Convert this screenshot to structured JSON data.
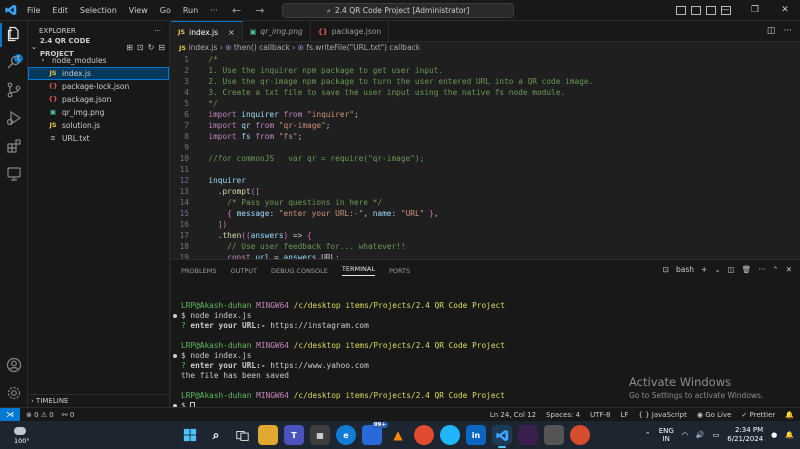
{
  "titlebar": {
    "menu": [
      "File",
      "Edit",
      "Selection",
      "View",
      "Go",
      "Run",
      "···"
    ],
    "search": "2.4 QR Code Project [Administrator]"
  },
  "sidebar": {
    "title": "EXPLORER",
    "more": "···",
    "project": "2.4 QR CODE PROJECT",
    "items": [
      {
        "icon": "›",
        "label": "node_modules",
        "color": "#cccccc"
      },
      {
        "icon": "JS",
        "label": "index.js",
        "color": "#cccccc"
      },
      {
        "icon": "{}",
        "label": "package-lock.json",
        "color": "#cccccc"
      },
      {
        "icon": "{}",
        "label": "package.json",
        "color": "#cccccc"
      },
      {
        "icon": "▣",
        "label": "qr_img.png",
        "color": "#cccccc"
      },
      {
        "icon": "JS",
        "label": "solution.js",
        "color": "#cccccc"
      },
      {
        "icon": "≡",
        "label": "URL.txt",
        "color": "#cccccc"
      }
    ],
    "timeline": "TIMELINE"
  },
  "tabs": [
    {
      "icon": "JS",
      "label": "index.js",
      "close": "×"
    },
    {
      "icon": "▣",
      "label": "qr_img.png"
    },
    {
      "icon": "{}",
      "label": "package.json"
    }
  ],
  "breadcrumbs": {
    "file": "index.js",
    "sep": " › ",
    "fn1": "then() callback",
    "fn2": "fs.writeFile(\"URL.txt\") callback"
  },
  "code": [
    {
      "n": "1",
      "t": "  /*"
    },
    {
      "n": "2",
      "t": "  1. Use the inquirer npm package to get user input."
    },
    {
      "n": "3",
      "t": "  2. Use the qr-image npm package to turn the user entered URL into a QR code image."
    },
    {
      "n": "4",
      "t": "  3. Create a txt file to save the user input using the native fs node module."
    },
    {
      "n": "5",
      "t": "  */"
    },
    {
      "n": "6",
      "t": "  import inquirer from \"inquirer\";"
    },
    {
      "n": "7",
      "t": "  import qr from \"qr-image\";"
    },
    {
      "n": "8",
      "t": "  import fs from \"fs\";"
    },
    {
      "n": "9",
      "t": ""
    },
    {
      "n": "10",
      "t": "  //for commonJS   var qr = require(\"qr-image\");"
    },
    {
      "n": "11",
      "t": ""
    },
    {
      "n": "12",
      "t": "  inquirer"
    },
    {
      "n": "13",
      "t": "    .prompt(["
    },
    {
      "n": "14",
      "t": "      /* Pass your questions in here */"
    },
    {
      "n": "15",
      "t": "      { message: \"enter your URL:-\", name: \"URL\" },"
    },
    {
      "n": "16",
      "t": "    ])"
    },
    {
      "n": "17",
      "t": "    .then((answers) => {"
    },
    {
      "n": "18",
      "t": "      // Use user feedback for... whatever!!"
    },
    {
      "n": "19",
      "t": "      const url = answers.URL;"
    }
  ],
  "panel": {
    "tabs": [
      "PROBLEMS",
      "OUTPUT",
      "DEBUG CONSOLE",
      "TERMINAL",
      "PORTS"
    ],
    "shell": "bash",
    "add": "+",
    "more": "···"
  },
  "terminal": {
    "user": "LRP@Akash-duhan",
    "host": "MINGW64",
    "path": "/c/desktop items/Projects/2.4 QR Code Project",
    "prompt": "$",
    "cmd": "node index.js",
    "q": "?",
    "q1": " enter your URL:-",
    "a1": " https://instagram.com",
    "a2": " https://www.yahoo.com",
    "saved": "the file has been saved"
  },
  "watermark": {
    "title": "Activate Windows",
    "subtitle": "Go to Settings to activate Windows."
  },
  "statusbar": {
    "errors": "⊗ 0 ⚠ 0",
    "ports": "⚯ 0",
    "position": "Ln 24, Col 12",
    "spaces": "Spaces: 4",
    "encoding": "UTF-8",
    "eol": "LF",
    "language": "{ } JavaScript",
    "golive": "Go Live",
    "prettier": "✓ Prettier"
  },
  "taskbar": {
    "temp": "100°",
    "badge": "99+",
    "lang_top": "ENG",
    "lang_bottom": "IN",
    "time": "2:34 PM",
    "date": "6/21/2024"
  }
}
